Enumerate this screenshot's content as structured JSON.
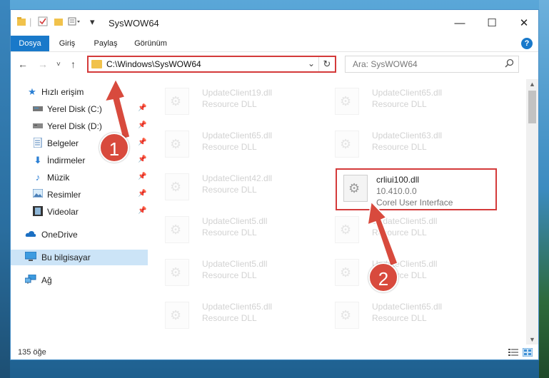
{
  "window": {
    "title": "SysWOW64",
    "controls": {
      "minimize": "—",
      "maximize": "☐",
      "close": "✕"
    }
  },
  "ribbon": {
    "tabs": [
      {
        "label": "Dosya",
        "active": true
      },
      {
        "label": "Giriş"
      },
      {
        "label": "Paylaş"
      },
      {
        "label": "Görünüm"
      }
    ],
    "help": "?"
  },
  "nav": {
    "address": "C:\\Windows\\SysWOW64",
    "search_placeholder": "Ara: SysWOW64"
  },
  "sidebar": {
    "items": [
      {
        "label": "Hızlı erişim",
        "icon": "star-icon"
      },
      {
        "label": "Yerel Disk (C:)",
        "icon": "drive-icon",
        "pinned": true
      },
      {
        "label": "Yerel Disk (D:)",
        "icon": "drive-icon",
        "pinned": true
      },
      {
        "label": "Belgeler",
        "icon": "documents-icon",
        "pinned": true
      },
      {
        "label": "İndirmeler",
        "icon": "download-icon",
        "pinned": true
      },
      {
        "label": "Müzik",
        "icon": "music-icon",
        "pinned": true
      },
      {
        "label": "Resimler",
        "icon": "pictures-icon",
        "pinned": true
      },
      {
        "label": "Videolar",
        "icon": "video-icon",
        "pinned": true
      },
      {
        "label": "OneDrive",
        "icon": "cloud-icon"
      },
      {
        "label": "Bu bilgisayar",
        "icon": "computer-icon",
        "selected": true
      },
      {
        "label": "Ağ",
        "icon": "network-icon"
      }
    ]
  },
  "files": {
    "left": [
      {
        "name": "UpdateClient19.dll",
        "type": "Resource DLL"
      },
      {
        "name": "UpdateClient65.dll",
        "type": "Resource DLL"
      },
      {
        "name": "UpdateClient42.dll",
        "type": "Resource DLL"
      },
      {
        "name": "UpdateClient5.dll",
        "type": "Resource DLL"
      },
      {
        "name": "UpdateClient5.dll",
        "type": "Resource DLL"
      },
      {
        "name": "UpdateClient65.dll",
        "type": "Resource DLL"
      }
    ],
    "right": [
      {
        "name": "UpdateClient65.dll",
        "type": "Resource DLL"
      },
      {
        "name": "UpdateClient63.dll",
        "type": "Resource DLL"
      },
      {
        "name": "UpdateClient5.dll",
        "type": "Resource DLL"
      },
      {
        "name": "UpdateClient5.dll",
        "type": "Resource DLL"
      },
      {
        "name": "UpdateClient65.dll",
        "type": "Resource DLL"
      }
    ],
    "highlighted": {
      "name": "crliui100.dll",
      "version": "10.410.0.0",
      "description": "Corel User Interface"
    }
  },
  "status": {
    "count": "135 öğe"
  },
  "annotations": {
    "step1": "1",
    "step2": "2"
  },
  "colors": {
    "accent": "#1979ca",
    "highlight": "#d43a3a",
    "badge": "#d84a3d"
  }
}
